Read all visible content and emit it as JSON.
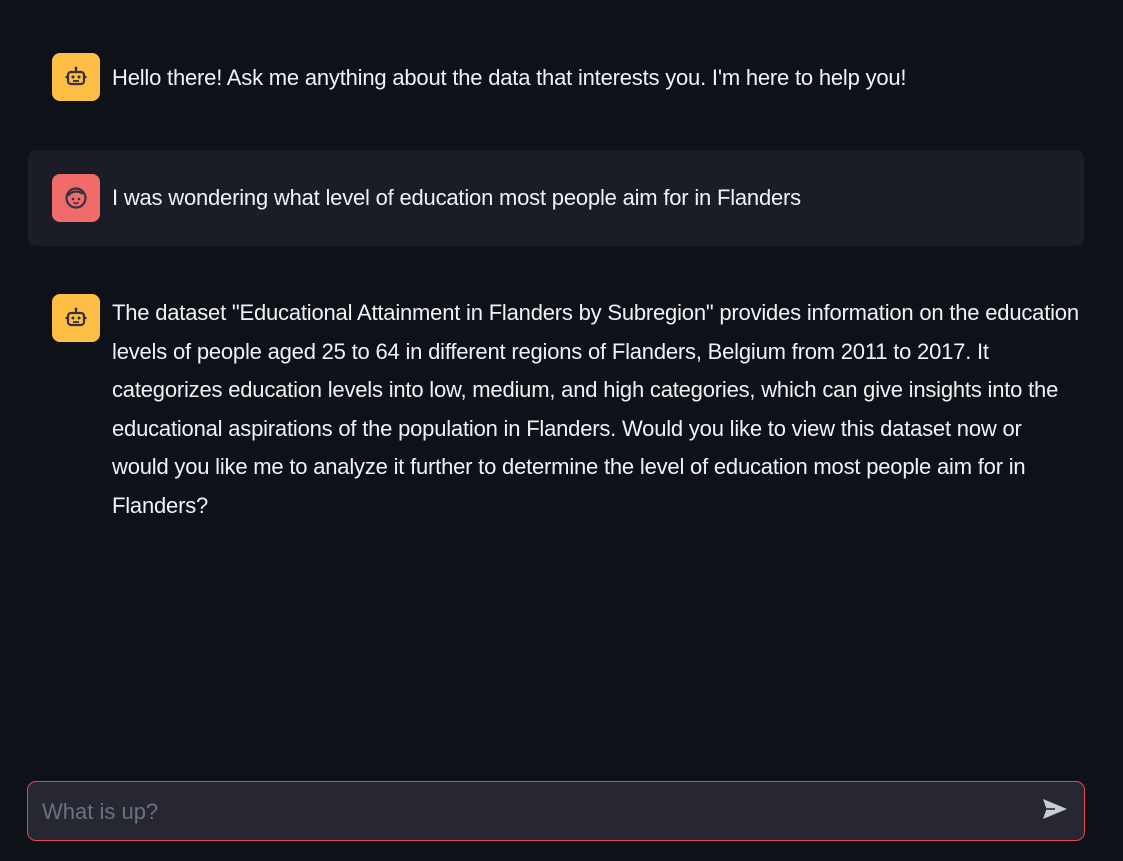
{
  "messages": [
    {
      "role": "assistant",
      "avatar_icon": "robot-icon",
      "text": "Hello there! Ask me anything about the data that interests you. I'm here to help you!"
    },
    {
      "role": "user",
      "avatar_icon": "user-face-icon",
      "text": "I was wondering what level of education most people aim for in Flanders"
    },
    {
      "role": "assistant",
      "avatar_icon": "robot-icon",
      "text": "The dataset \"Educational Attainment in Flanders by Subregion\" provides information on the education levels of people aged 25 to 64 in different regions of Flanders, Belgium from 2011 to 2017. It categorizes education levels into low, medium, and high categories, which can give insights into the educational aspirations of the population in Flanders. Would you like to view this dataset now or would you like me to analyze it further to determine the level of education most people aim for in Flanders?"
    }
  ],
  "chat_input": {
    "value": "",
    "placeholder": "What is up?",
    "send_icon": "send-arrow-icon"
  },
  "colors": {
    "background": "#0e1117",
    "user_bubble": "#1a1d26",
    "bot_avatar": "#fdbe43",
    "user_avatar": "#f26b6b",
    "input_border": "#e0494f",
    "input_background": "#262730"
  }
}
